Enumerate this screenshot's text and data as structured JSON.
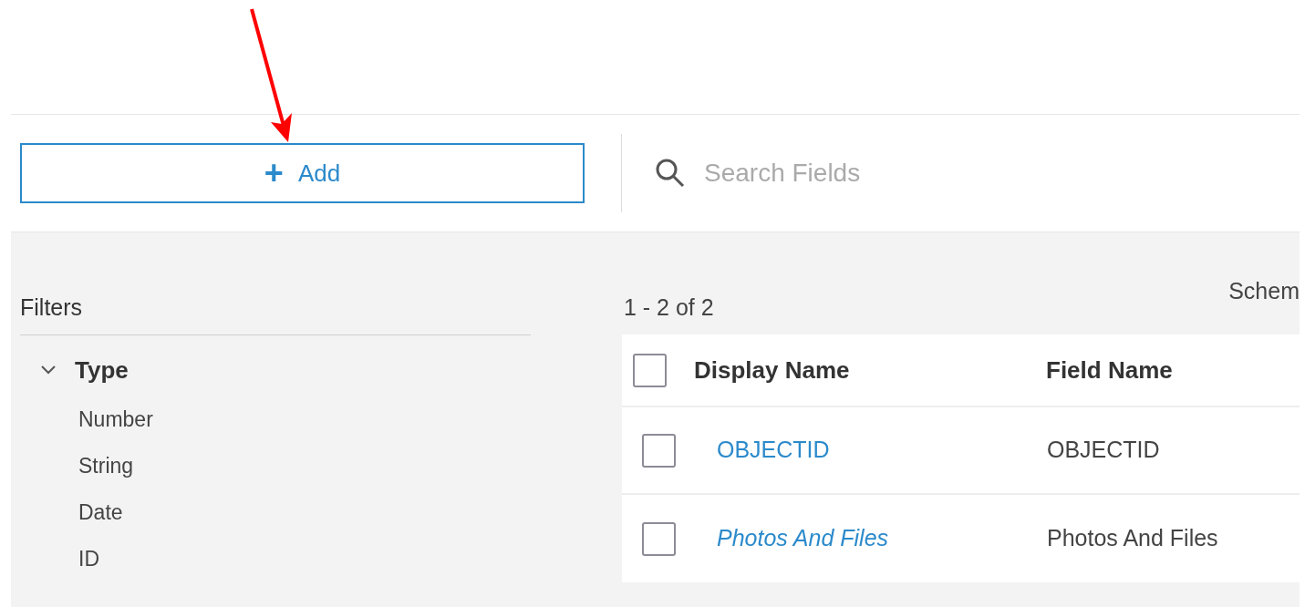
{
  "toolbar": {
    "add_button": {
      "icon": "+",
      "label": "Add"
    },
    "search": {
      "placeholder": "Search Fields"
    }
  },
  "filters": {
    "title": "Filters",
    "groups": [
      {
        "label": "Type",
        "expanded": true,
        "items": [
          "Number",
          "String",
          "Date",
          "ID"
        ]
      }
    ]
  },
  "results": {
    "count": "1 - 2 of 2",
    "view_label": "Schem"
  },
  "table": {
    "select_all": {
      "checked": false
    },
    "columns": [
      "Display Name",
      "Field Name"
    ],
    "rows": [
      {
        "checked": false,
        "display_name": "OBJECTID",
        "italic": false,
        "field_name": "OBJECTID"
      },
      {
        "checked": false,
        "display_name": "Photos And Files",
        "italic": true,
        "field_name": "Photos And Files"
      }
    ]
  }
}
